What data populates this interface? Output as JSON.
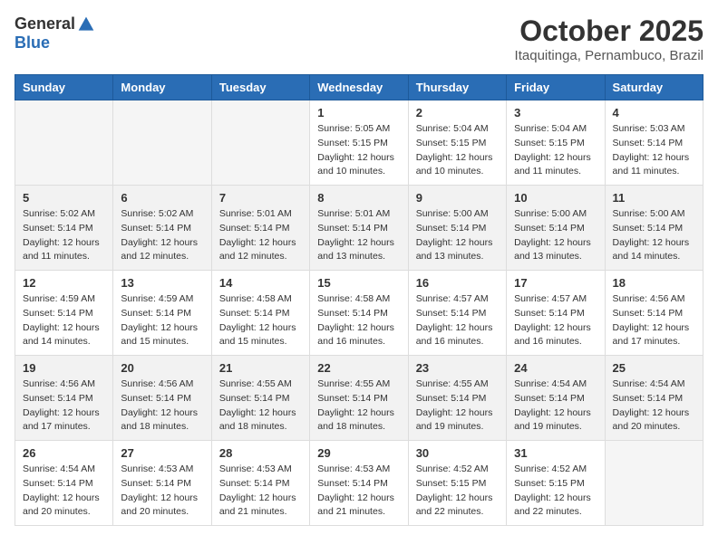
{
  "logo": {
    "general": "General",
    "blue": "Blue"
  },
  "header": {
    "month": "October 2025",
    "location": "Itaquitinga, Pernambuco, Brazil"
  },
  "weekdays": [
    "Sunday",
    "Monday",
    "Tuesday",
    "Wednesday",
    "Thursday",
    "Friday",
    "Saturday"
  ],
  "weeks": [
    [
      {
        "day": "",
        "info": ""
      },
      {
        "day": "",
        "info": ""
      },
      {
        "day": "",
        "info": ""
      },
      {
        "day": "1",
        "info": "Sunrise: 5:05 AM\nSunset: 5:15 PM\nDaylight: 12 hours\nand 10 minutes."
      },
      {
        "day": "2",
        "info": "Sunrise: 5:04 AM\nSunset: 5:15 PM\nDaylight: 12 hours\nand 10 minutes."
      },
      {
        "day": "3",
        "info": "Sunrise: 5:04 AM\nSunset: 5:15 PM\nDaylight: 12 hours\nand 11 minutes."
      },
      {
        "day": "4",
        "info": "Sunrise: 5:03 AM\nSunset: 5:14 PM\nDaylight: 12 hours\nand 11 minutes."
      }
    ],
    [
      {
        "day": "5",
        "info": "Sunrise: 5:02 AM\nSunset: 5:14 PM\nDaylight: 12 hours\nand 11 minutes."
      },
      {
        "day": "6",
        "info": "Sunrise: 5:02 AM\nSunset: 5:14 PM\nDaylight: 12 hours\nand 12 minutes."
      },
      {
        "day": "7",
        "info": "Sunrise: 5:01 AM\nSunset: 5:14 PM\nDaylight: 12 hours\nand 12 minutes."
      },
      {
        "day": "8",
        "info": "Sunrise: 5:01 AM\nSunset: 5:14 PM\nDaylight: 12 hours\nand 13 minutes."
      },
      {
        "day": "9",
        "info": "Sunrise: 5:00 AM\nSunset: 5:14 PM\nDaylight: 12 hours\nand 13 minutes."
      },
      {
        "day": "10",
        "info": "Sunrise: 5:00 AM\nSunset: 5:14 PM\nDaylight: 12 hours\nand 13 minutes."
      },
      {
        "day": "11",
        "info": "Sunrise: 5:00 AM\nSunset: 5:14 PM\nDaylight: 12 hours\nand 14 minutes."
      }
    ],
    [
      {
        "day": "12",
        "info": "Sunrise: 4:59 AM\nSunset: 5:14 PM\nDaylight: 12 hours\nand 14 minutes."
      },
      {
        "day": "13",
        "info": "Sunrise: 4:59 AM\nSunset: 5:14 PM\nDaylight: 12 hours\nand 15 minutes."
      },
      {
        "day": "14",
        "info": "Sunrise: 4:58 AM\nSunset: 5:14 PM\nDaylight: 12 hours\nand 15 minutes."
      },
      {
        "day": "15",
        "info": "Sunrise: 4:58 AM\nSunset: 5:14 PM\nDaylight: 12 hours\nand 16 minutes."
      },
      {
        "day": "16",
        "info": "Sunrise: 4:57 AM\nSunset: 5:14 PM\nDaylight: 12 hours\nand 16 minutes."
      },
      {
        "day": "17",
        "info": "Sunrise: 4:57 AM\nSunset: 5:14 PM\nDaylight: 12 hours\nand 16 minutes."
      },
      {
        "day": "18",
        "info": "Sunrise: 4:56 AM\nSunset: 5:14 PM\nDaylight: 12 hours\nand 17 minutes."
      }
    ],
    [
      {
        "day": "19",
        "info": "Sunrise: 4:56 AM\nSunset: 5:14 PM\nDaylight: 12 hours\nand 17 minutes."
      },
      {
        "day": "20",
        "info": "Sunrise: 4:56 AM\nSunset: 5:14 PM\nDaylight: 12 hours\nand 18 minutes."
      },
      {
        "day": "21",
        "info": "Sunrise: 4:55 AM\nSunset: 5:14 PM\nDaylight: 12 hours\nand 18 minutes."
      },
      {
        "day": "22",
        "info": "Sunrise: 4:55 AM\nSunset: 5:14 PM\nDaylight: 12 hours\nand 18 minutes."
      },
      {
        "day": "23",
        "info": "Sunrise: 4:55 AM\nSunset: 5:14 PM\nDaylight: 12 hours\nand 19 minutes."
      },
      {
        "day": "24",
        "info": "Sunrise: 4:54 AM\nSunset: 5:14 PM\nDaylight: 12 hours\nand 19 minutes."
      },
      {
        "day": "25",
        "info": "Sunrise: 4:54 AM\nSunset: 5:14 PM\nDaylight: 12 hours\nand 20 minutes."
      }
    ],
    [
      {
        "day": "26",
        "info": "Sunrise: 4:54 AM\nSunset: 5:14 PM\nDaylight: 12 hours\nand 20 minutes."
      },
      {
        "day": "27",
        "info": "Sunrise: 4:53 AM\nSunset: 5:14 PM\nDaylight: 12 hours\nand 20 minutes."
      },
      {
        "day": "28",
        "info": "Sunrise: 4:53 AM\nSunset: 5:14 PM\nDaylight: 12 hours\nand 21 minutes."
      },
      {
        "day": "29",
        "info": "Sunrise: 4:53 AM\nSunset: 5:14 PM\nDaylight: 12 hours\nand 21 minutes."
      },
      {
        "day": "30",
        "info": "Sunrise: 4:52 AM\nSunset: 5:15 PM\nDaylight: 12 hours\nand 22 minutes."
      },
      {
        "day": "31",
        "info": "Sunrise: 4:52 AM\nSunset: 5:15 PM\nDaylight: 12 hours\nand 22 minutes."
      },
      {
        "day": "",
        "info": ""
      }
    ]
  ]
}
